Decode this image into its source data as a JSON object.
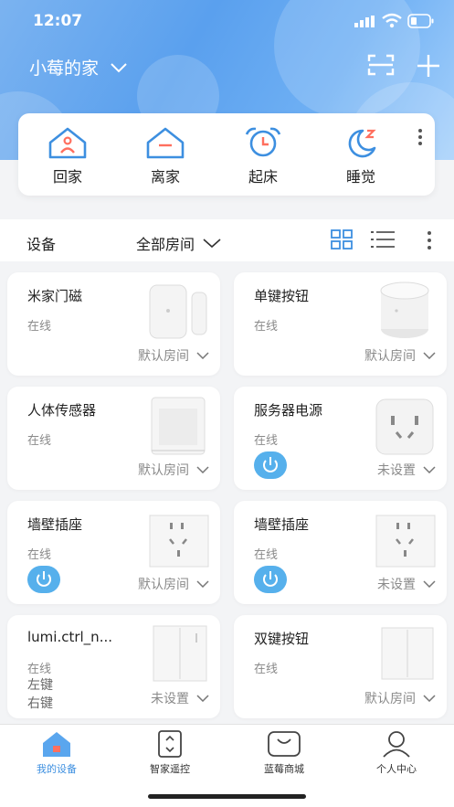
{
  "status_bar": {
    "time": "12:07"
  },
  "header": {
    "home_name": "小莓的家"
  },
  "scenes": [
    {
      "label": "回家",
      "icon": "home-person-icon"
    },
    {
      "label": "离家",
      "icon": "home-leave-icon"
    },
    {
      "label": "起床",
      "icon": "alarm-clock-icon"
    },
    {
      "label": "睡觉",
      "icon": "moon-icon"
    }
  ],
  "toolbar": {
    "devices_label": "设备",
    "rooms_label": "全部房间"
  },
  "devices": [
    {
      "name": "米家门磁",
      "status": "在线",
      "room": "默认房间"
    },
    {
      "name": "单键按钮",
      "status": "在线",
      "room": "默认房间"
    },
    {
      "name": "人体传感器",
      "status": "在线",
      "room": "默认房间"
    },
    {
      "name": "服务器电源",
      "status": "在线",
      "room": "未设置"
    },
    {
      "name": "墙壁插座",
      "status": "在线",
      "room": "默认房间"
    },
    {
      "name": "墙壁插座",
      "status": "在线",
      "room": "未设置"
    },
    {
      "name": "lumi.ctrl_n...",
      "status": "在线",
      "extra1": "左键",
      "extra2": "右键",
      "room": "未设置"
    },
    {
      "name": "双键按钮",
      "status": "在线",
      "room": "默认房间"
    }
  ],
  "tabs": [
    {
      "label": "我的设备",
      "icon": "home-icon",
      "active": true
    },
    {
      "label": "智家遥控",
      "icon": "remote-icon",
      "active": false
    },
    {
      "label": "蓝莓商城",
      "icon": "shop-bag-icon",
      "active": false
    },
    {
      "label": "个人中心",
      "icon": "person-icon",
      "active": false
    }
  ],
  "colors": {
    "accent": "#3d8fe0",
    "power_button": "#56b0ec",
    "header_gradient": "#5aa0ee"
  }
}
